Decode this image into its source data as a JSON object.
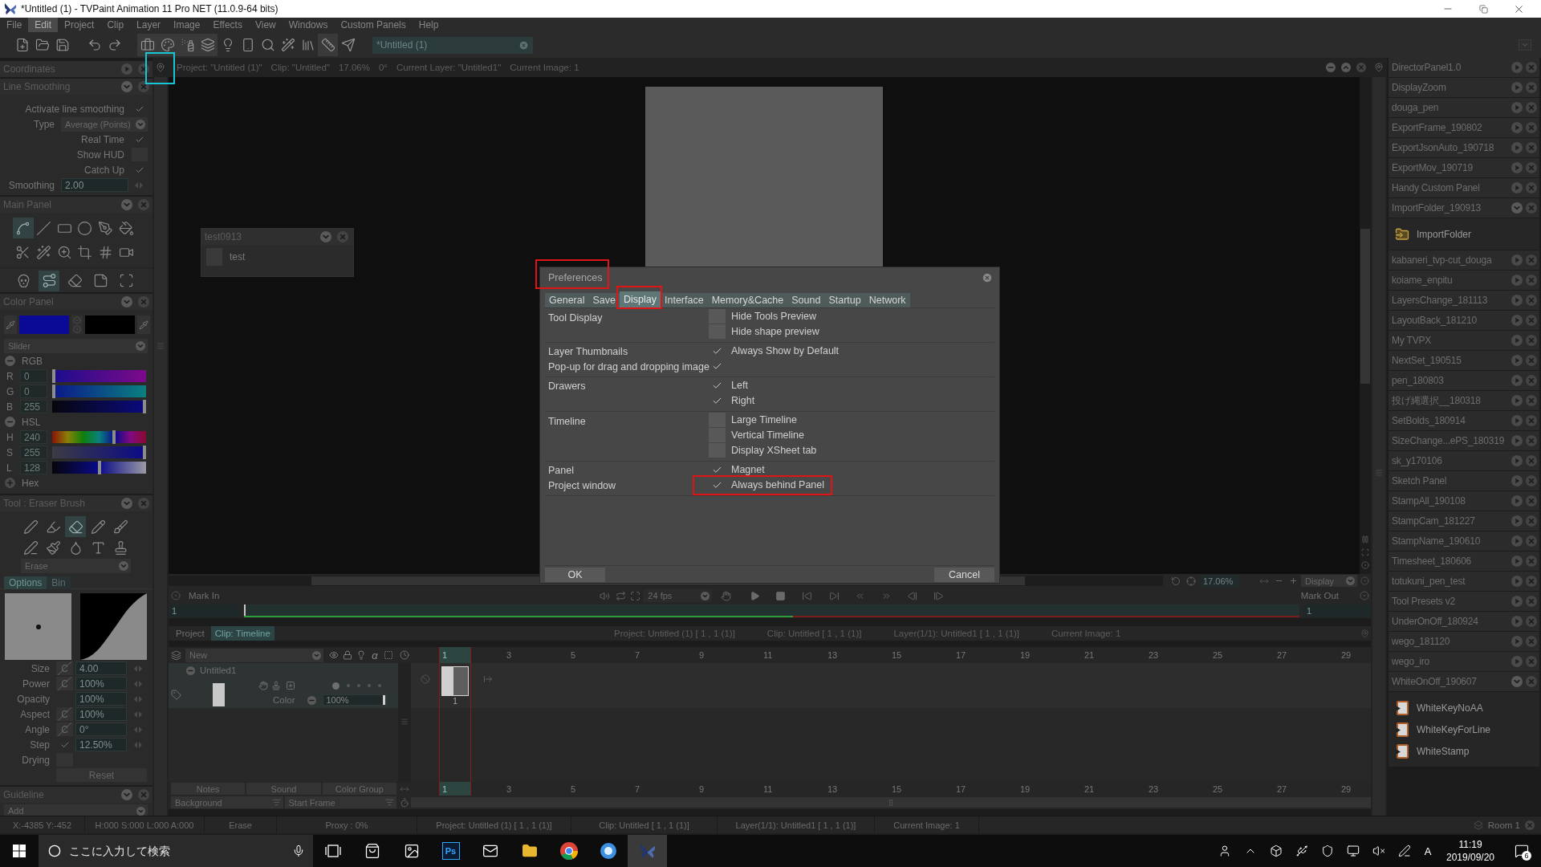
{
  "window": {
    "title": "*Untitled (1) - TVPaint Animation 11 Pro NET (11.0.9-64 bits)"
  },
  "menu": [
    {
      "label": "File",
      "selected": false
    },
    {
      "label": "Edit",
      "selected": true
    },
    {
      "label": "Project",
      "selected": false
    },
    {
      "label": "Clip",
      "selected": false
    },
    {
      "label": "Layer",
      "selected": false
    },
    {
      "label": "Image",
      "selected": false
    },
    {
      "label": "Effects",
      "selected": false
    },
    {
      "label": "View",
      "selected": false
    },
    {
      "label": "Windows",
      "selected": false
    },
    {
      "label": "Custom Panels",
      "selected": false
    },
    {
      "label": "Help",
      "selected": false
    }
  ],
  "toolbar": {
    "buttons": [
      {
        "kind": "new",
        "selected": false
      },
      {
        "kind": "open",
        "selected": false
      },
      {
        "kind": "save",
        "selected": false
      },
      {
        "kind": "undo",
        "selected": false
      },
      {
        "kind": "redo",
        "selected": false
      },
      {
        "kind": "toolbox",
        "selected": true
      },
      {
        "kind": "color",
        "selected": true
      },
      {
        "kind": "spray",
        "selected": true
      },
      {
        "kind": "layers",
        "selected": true
      },
      {
        "kind": "light",
        "selected": false
      },
      {
        "kind": "remote",
        "selected": false
      },
      {
        "kind": "search",
        "selected": false
      },
      {
        "kind": "wand",
        "selected": false
      },
      {
        "kind": "library",
        "selected": false
      },
      {
        "kind": "ruler",
        "selected": true
      },
      {
        "kind": "send",
        "selected": false
      }
    ],
    "project": "*Untitled (1)"
  },
  "coordinates_panel": {
    "title": "Coordinates",
    "expanded": false
  },
  "line_smoothing": {
    "title": "Line Smoothing",
    "expanded": true,
    "options": [
      {
        "kind": "check",
        "label": "Activate line smoothing",
        "checked": true
      },
      {
        "kind": "select",
        "label": "Type",
        "value": "Average (Points)"
      },
      {
        "kind": "check",
        "label": "Real Time",
        "checked": true
      },
      {
        "kind": "check",
        "label": "Show HUD",
        "checked": false
      },
      {
        "kind": "check",
        "label": "Catch Up",
        "checked": true
      },
      {
        "kind": "number",
        "label": "Smoothing",
        "value": "2.00"
      }
    ]
  },
  "main_panel": {
    "title": "Main Panel",
    "expanded": true,
    "rows": [
      {
        "tools": [
          {
            "kind": "freehand",
            "selected": true
          },
          {
            "kind": "line",
            "selected": false
          },
          {
            "kind": "rect",
            "selected": false
          },
          {
            "kind": "ellipse",
            "selected": false
          },
          {
            "kind": "spline",
            "selected": false
          },
          {
            "kind": "ink",
            "selected": false
          }
        ]
      },
      {
        "tools": [
          {
            "kind": "cut",
            "selected": false
          },
          {
            "kind": "wand",
            "selected": false
          },
          {
            "kind": "zoom",
            "selected": false
          },
          {
            "kind": "crop",
            "selected": false
          },
          {
            "kind": "grid",
            "selected": false
          },
          {
            "kind": "camera",
            "selected": false
          }
        ]
      },
      {
        "tools": [
          {
            "kind": "skull",
            "selected": false
          },
          {
            "kind": "warp",
            "selected": true
          },
          {
            "kind": "eraser",
            "selected": false
          },
          {
            "kind": "paper",
            "selected": false
          },
          {
            "kind": "stencil",
            "selected": false
          }
        ]
      }
    ]
  },
  "color_panel": {
    "title": "Color Panel",
    "expanded": true,
    "swatches": [
      {
        "color": "#0a0a96"
      },
      {
        "color": "#000000"
      }
    ],
    "mode": "Slider",
    "groups": [
      {
        "name": "RGB",
        "expanded": true,
        "channels": [
          {
            "kind": "r",
            "label": "R",
            "value": "0",
            "level": 0
          },
          {
            "kind": "g",
            "label": "G",
            "value": "0",
            "level": 0
          },
          {
            "kind": "b",
            "label": "B",
            "value": "255",
            "level": 1
          }
        ]
      },
      {
        "name": "HSL",
        "expanded": true,
        "channels": [
          {
            "kind": "h",
            "label": "H",
            "value": "240",
            "level": 0.667
          },
          {
            "kind": "s",
            "label": "S",
            "value": "255",
            "level": 1
          },
          {
            "kind": "l",
            "label": "L",
            "value": "128",
            "level": 0.5
          }
        ]
      },
      {
        "name": "Hex",
        "expanded": false
      }
    ]
  },
  "tool_panel": {
    "title": "Tool : Eraser Brush",
    "expanded": true,
    "rows": [
      {
        "tools": [
          {
            "kind": "pen",
            "selected": false
          },
          {
            "kind": "marker",
            "selected": false
          },
          {
            "kind": "eraser",
            "selected": true
          },
          {
            "kind": "pencil",
            "selected": false
          },
          {
            "kind": "brush",
            "selected": false
          }
        ]
      },
      {
        "tools": [
          {
            "kind": "airbrush",
            "selected": false
          },
          {
            "kind": "paint",
            "selected": false
          },
          {
            "kind": "water",
            "selected": false
          },
          {
            "kind": "text",
            "selected": false
          },
          {
            "kind": "stamp",
            "selected": false
          }
        ]
      }
    ],
    "mode": "Erase",
    "tabs": [
      {
        "label": "Options",
        "selected": true
      },
      {
        "label": "Bin",
        "selected": false
      }
    ],
    "params": [
      {
        "kind": "pressure",
        "label": "Size",
        "pressure": "C",
        "value": "4.00"
      },
      {
        "kind": "pressure",
        "label": "Power",
        "pressure": "C",
        "value": "100%"
      },
      {
        "kind": "plain",
        "label": "Opacity",
        "value": "100%"
      },
      {
        "kind": "pressure",
        "label": "Aspect",
        "pressure": "C",
        "value": "100%"
      },
      {
        "kind": "pressure",
        "label": "Angle",
        "pressure": "C",
        "value": "0°"
      },
      {
        "kind": "check",
        "label": "Step",
        "checked": true,
        "value": "12.50%"
      },
      {
        "kind": "toggle",
        "label": "Drying",
        "checked": false
      }
    ],
    "reset": "Reset"
  },
  "guideline_panel": {
    "title": "Guideline",
    "expanded": true,
    "action": "Add"
  },
  "project_window": {
    "pin_marked": true,
    "info": [
      "Project: \"Untitled (1)\"",
      "Clip: \"Untitled\"",
      "17.06%",
      "0°",
      "Current Layer: \"Untitled1\"",
      "Current Image: 1"
    ],
    "zoom": "17.06%",
    "view_mode": "Display"
  },
  "floating_panel": {
    "title": "test0913",
    "expanded": true,
    "buttons": [
      "test"
    ]
  },
  "preferences": {
    "title": "Preferences",
    "title_marked": true,
    "tabs": [
      {
        "label": "General",
        "selected": false,
        "marked": false
      },
      {
        "label": "Save",
        "selected": false,
        "marked": false
      },
      {
        "label": "Display",
        "selected": true,
        "marked": true
      },
      {
        "label": "Interface",
        "selected": false,
        "marked": false
      },
      {
        "label": "Memory&Cache",
        "selected": false,
        "marked": false
      },
      {
        "label": "Sound",
        "selected": false,
        "marked": false
      },
      {
        "label": "Startup",
        "selected": false,
        "marked": false
      },
      {
        "label": "Network",
        "selected": false,
        "marked": false
      }
    ],
    "sections": [
      {
        "rows": [
          {
            "label": "Tool Display",
            "option": "Hide Tools Preview",
            "checked": false,
            "marked": false
          },
          {
            "option": "Hide shape preview",
            "checked": false,
            "marked": false
          }
        ]
      },
      {
        "rows": [
          {
            "label": "Layer Thumbnails",
            "option": "Always Show by Default",
            "checked": true,
            "marked": false
          },
          {
            "label": "Pop-up for drag and dropping image",
            "checked": true,
            "marked": false
          }
        ]
      },
      {
        "rows": [
          {
            "label": "Drawers",
            "option": "Left",
            "checked": true,
            "marked": false
          },
          {
            "option": "Right",
            "checked": true,
            "marked": false
          }
        ]
      },
      {
        "rows": [
          {
            "label": "Timeline",
            "option": "Large Timeline",
            "checked": false,
            "marked": false
          },
          {
            "option": "Vertical Timeline",
            "checked": false,
            "marked": false
          },
          {
            "option": "Display XSheet tab",
            "checked": false,
            "marked": false
          }
        ]
      },
      {
        "rows": [
          {
            "label": "Panel",
            "option": "Magnet",
            "checked": true,
            "marked": false
          },
          {
            "label": "Project window",
            "option": "Always behind Panel",
            "checked": true,
            "marked": true
          }
        ]
      }
    ],
    "ok": "OK",
    "cancel": "Cancel"
  },
  "playback": {
    "mark_in": "Mark In",
    "fps": "24 fps",
    "mark_out": "Mark Out",
    "start": "1",
    "end": "1",
    "level": 0.52
  },
  "timeline": {
    "tabs": [
      {
        "label": "Project",
        "selected": false
      },
      {
        "label": "Clip: Timeline",
        "selected": true
      }
    ],
    "info": [
      "Project: Untitled (1) [ 1 , 1 (1)]",
      "Clip: Untitled [ 1 , 1 (1)]",
      "Layer(1/1): Untitled1 [ 1 , 1 (1)]",
      "Current Image: 1"
    ],
    "new_layer": "New",
    "alpha": "α",
    "ruler": [
      {
        "label": "1",
        "selected": true
      },
      {
        "label": "3",
        "selected": false
      },
      {
        "label": "5",
        "selected": false
      },
      {
        "label": "7",
        "selected": false
      },
      {
        "label": "9",
        "selected": false
      },
      {
        "label": "11",
        "selected": false
      },
      {
        "label": "13",
        "selected": false
      },
      {
        "label": "15",
        "selected": false
      },
      {
        "label": "17",
        "selected": false
      },
      {
        "label": "19",
        "selected": false
      },
      {
        "label": "21",
        "selected": false
      },
      {
        "label": "23",
        "selected": false
      },
      {
        "label": "25",
        "selected": false
      },
      {
        "label": "27",
        "selected": false
      },
      {
        "label": "29",
        "selected": false
      }
    ],
    "layers": [
      {
        "name": "Untitled1",
        "expanded": true,
        "color_label": "Color",
        "opacity": {
          "value": "100%",
          "level": 1
        },
        "frames": [
          {
            "label": "1",
            "selected": true
          }
        ]
      }
    ],
    "footer_buttons": [
      "Notes",
      "Sound",
      "Color Group"
    ],
    "footer_ruler": [
      {
        "label": "1",
        "selected": true
      },
      {
        "label": "3",
        "selected": false
      },
      {
        "label": "5",
        "selected": false
      },
      {
        "label": "7",
        "selected": false
      },
      {
        "label": "9",
        "selected": false
      },
      {
        "label": "11",
        "selected": false
      },
      {
        "label": "13",
        "selected": false
      },
      {
        "label": "15",
        "selected": false
      },
      {
        "label": "17",
        "selected": false
      },
      {
        "label": "19",
        "selected": false
      },
      {
        "label": "21",
        "selected": false
      },
      {
        "label": "23",
        "selected": false
      },
      {
        "label": "25",
        "selected": false
      },
      {
        "label": "27",
        "selected": false
      },
      {
        "label": "29",
        "selected": false
      }
    ],
    "background": "Background",
    "start_frame": "Start Frame"
  },
  "custom_panels": [
    {
      "name": "DirectorPanel1.0",
      "expanded": false
    },
    {
      "name": "DisplayZoom",
      "expanded": false
    },
    {
      "name": "douga_pen",
      "expanded": false
    },
    {
      "name": "ExportFrame_190802",
      "expanded": false
    },
    {
      "name": "ExportJsonAuto_190718",
      "expanded": false
    },
    {
      "name": "ExportMov_190719",
      "expanded": false
    },
    {
      "name": "Handy Custom Panel",
      "expanded": false
    },
    {
      "name": "ImportFolder_190913",
      "expanded": true,
      "children": [
        {
          "name": "ImportFolder",
          "kind": "folder"
        }
      ]
    },
    {
      "name": "kabaneri_tvp-cut_douga",
      "expanded": false
    },
    {
      "name": "koiame_enpitu",
      "expanded": false
    },
    {
      "name": "LayersChange_181113",
      "expanded": false
    },
    {
      "name": "LayoutBack_181210",
      "expanded": false
    },
    {
      "name": "My TVPX",
      "expanded": false
    },
    {
      "name": "NextSet_190515",
      "expanded": false
    },
    {
      "name": "pen_180803",
      "expanded": false
    },
    {
      "name": "投げ縄選択__180318",
      "expanded": false
    },
    {
      "name": "SetBolds_180914",
      "expanded": false
    },
    {
      "name": "SizeChange...ePS_180319",
      "expanded": false
    },
    {
      "name": "sk_y170106",
      "expanded": false
    },
    {
      "name": "Sketch Panel",
      "expanded": false
    },
    {
      "name": "StampAll_190108",
      "expanded": false
    },
    {
      "name": "StampCam_181227",
      "expanded": false
    },
    {
      "name": "StampName_190610",
      "expanded": false
    },
    {
      "name": "Timesheet_180606",
      "expanded": false
    },
    {
      "name": "totukuni_pen_test",
      "expanded": false
    },
    {
      "name": "Tool Presets v2",
      "expanded": false
    },
    {
      "name": "UnderOnOff_180924",
      "expanded": false
    },
    {
      "name": "wego_181120",
      "expanded": false
    },
    {
      "name": "wego_iro",
      "expanded": false
    },
    {
      "name": "WhiteOnOff_190607",
      "expanded": true,
      "children": [
        {
          "name": "WhiteKeyNoAA",
          "kind": "script"
        },
        {
          "name": "WhiteKeyForLine",
          "kind": "script"
        },
        {
          "name": "WhiteStamp",
          "kind": "script"
        }
      ]
    }
  ],
  "status_bar": {
    "items": [
      "X:-4385 Y:-452",
      "H:000 S:000 L:000 A:000",
      "Erase",
      "Proxy : 0%",
      "Project: Untitled (1) [ 1 , 1 (1)]",
      "Clip: Untitled [ 1 , 1 (1)]",
      "Layer(1/1): Untitled1 [ 1 , 1 (1)]",
      "Current Image: 1"
    ],
    "room": "Room 1"
  },
  "taskbar": {
    "search": {
      "placeholder": "ここに入力して検索"
    },
    "apps": [
      {
        "kind": "taskview",
        "selected": false
      },
      {
        "kind": "store",
        "selected": false
      },
      {
        "kind": "photos",
        "selected": false
      },
      {
        "kind": "photoshop",
        "label": "Ps",
        "selected": false
      },
      {
        "kind": "mail",
        "selected": false
      },
      {
        "kind": "explorer",
        "selected": false
      },
      {
        "kind": "chrome",
        "selected": false
      },
      {
        "kind": "app",
        "selected": false
      },
      {
        "kind": "tvpaint",
        "selected": true
      }
    ],
    "ime": "A",
    "time": "11:19",
    "date": "2019/09/20",
    "notifications": "6"
  }
}
